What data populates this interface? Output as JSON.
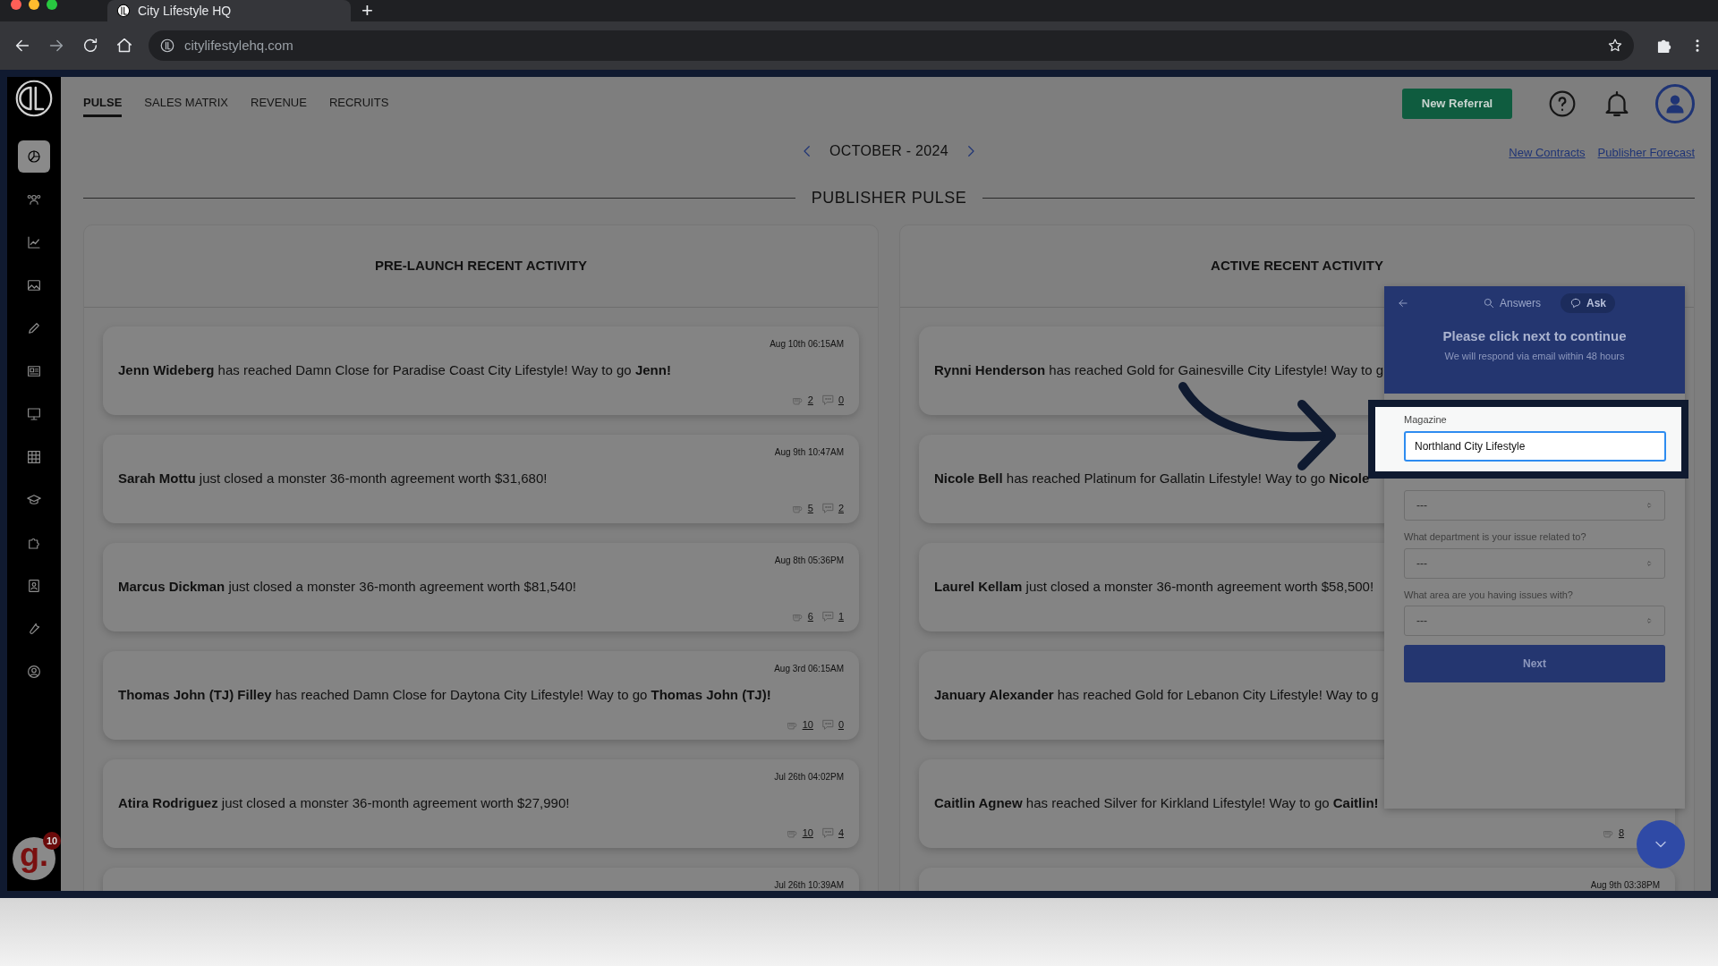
{
  "browser": {
    "tab_title": "City Lifestyle HQ",
    "new_tab": "+",
    "url": "citylifestylehq.com"
  },
  "nav": {
    "tabs": [
      {
        "label": "PULSE",
        "selected": true
      },
      {
        "label": "SALES MATRIX",
        "selected": false
      },
      {
        "label": "REVENUE",
        "selected": false
      },
      {
        "label": "RECRUITS",
        "selected": false
      }
    ],
    "new_referral": "New Referral"
  },
  "sidebar": {
    "items": [
      {
        "selected": true
      },
      {
        "selected": false
      },
      {
        "selected": false
      },
      {
        "selected": false
      },
      {
        "selected": false
      },
      {
        "selected": false
      },
      {
        "selected": false
      },
      {
        "selected": false
      },
      {
        "selected": false
      },
      {
        "selected": false
      },
      {
        "selected": false
      },
      {
        "selected": false
      },
      {
        "selected": false
      }
    ]
  },
  "help_badge": {
    "letter": "g.",
    "count": "10"
  },
  "period": "OCTOBER - 2024",
  "links": [
    "New Contracts",
    "Publisher Forecast"
  ],
  "section_title": "PUBLISHER PULSE",
  "columns": [
    {
      "title": "PRE-LAUNCH RECENT ACTIVITY",
      "cards": [
        {
          "time": "Aug 10th 06:15AM",
          "text": "**Jenn Wideberg** has reached Damn Close for Paradise Coast City Lifestyle! Way to go **Jenn!**",
          "fist_count": "2",
          "comment_count": "0"
        },
        {
          "time": "Aug 9th 10:47AM",
          "text": "**Sarah Mottu** just closed a monster 36-month agreement worth $31,680!",
          "fist_count": "5",
          "comment_count": "2"
        },
        {
          "time": "Aug 8th 05:36PM",
          "text": "**Marcus Dickman** just closed a monster 36-month agreement worth $81,540!",
          "fist_count": "6",
          "comment_count": "1"
        },
        {
          "time": "Aug 3rd 06:15AM",
          "text": "**Thomas John (TJ) Filley** has reached Damn Close for Daytona City Lifestyle! Way to go **Thomas John (TJ)!**",
          "fist_count": "10",
          "comment_count": "0"
        },
        {
          "time": "Jul 26th 04:02PM",
          "text": "**Atira Rodriguez** just closed a monster 36-month agreement worth $27,990!",
          "fist_count": "10",
          "comment_count": "4"
        },
        {
          "time": "Jul 26th 10:39AM"
        }
      ]
    },
    {
      "title": "ACTIVE RECENT ACTIVITY",
      "cards": [
        {
          "text": "**Rynni Henderson** has reached Gold for Gainesville City Lifestyle! Way to g"
        },
        {
          "text": "**Nicole Bell** has reached Platinum for Gallatin Lifestyle! Way to go **Nicole**"
        },
        {
          "text": "**Laurel Kellam** just closed a monster 36-month agreement worth $58,500!"
        },
        {
          "text": "**January Alexander** has reached Gold for Lebanon City Lifestyle! Way to g"
        },
        {
          "text": "**Caitlin Agnew** has reached Silver for Kirkland Lifestyle! Way to go **Caitlin!**",
          "fist_count": "8"
        },
        {
          "time": "Aug 9th 03:38PM"
        }
      ]
    }
  ],
  "support_widget": {
    "tabs": [
      {
        "label": "Answers",
        "selected": false
      },
      {
        "label": "Ask",
        "selected": true
      }
    ],
    "title": "Please click next to continue",
    "subtitle": "We will respond via email within 48 hours",
    "fields": [
      {
        "placeholder": "---"
      },
      {
        "label": "What department is your issue related to?",
        "placeholder": "---"
      },
      {
        "label": "What area are you having issues with?",
        "placeholder": "---"
      }
    ],
    "button": "Next"
  },
  "highlight": {
    "label": "Magazine",
    "value": "Northland City Lifestyle"
  }
}
